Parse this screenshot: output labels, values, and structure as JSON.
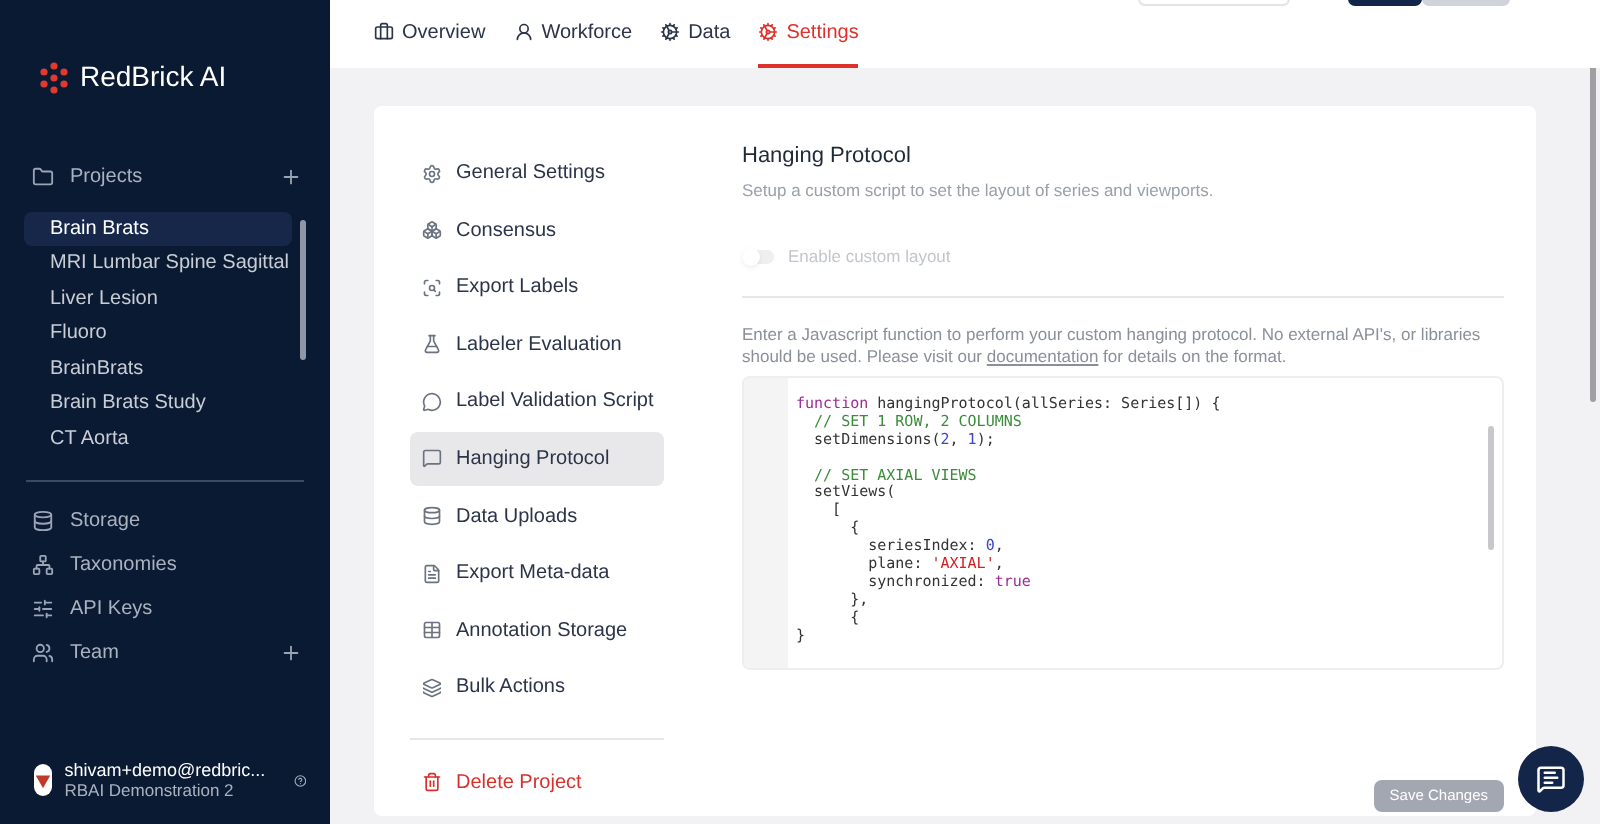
{
  "sidebar": {
    "logo": "RedBrick AI",
    "projects_header": {
      "label": "Projects",
      "add": true
    },
    "projects": [
      {
        "label": "Brain Brats",
        "selected": true
      },
      {
        "label": "MRI Lumbar Spine Sagittal",
        "selected": false
      },
      {
        "label": "Liver Lesion",
        "selected": false
      },
      {
        "label": "Fluoro",
        "selected": false
      },
      {
        "label": "BrainBrats",
        "selected": false
      },
      {
        "label": "Brain Brats Study",
        "selected": false
      },
      {
        "label": "CT Aorta",
        "selected": false
      }
    ],
    "nav": [
      {
        "label": "Storage",
        "add": false
      },
      {
        "label": "Taxonomies",
        "add": false
      },
      {
        "label": "API Keys",
        "add": false
      },
      {
        "label": "Team",
        "add": true
      }
    ],
    "user": {
      "email": "shivam+demo@redbric...",
      "org": "RBAI Demonstration 2"
    }
  },
  "tabs": [
    {
      "label": "Overview",
      "selected": false
    },
    {
      "label": "Workforce",
      "selected": false
    },
    {
      "label": "Data",
      "selected": false
    },
    {
      "label": "Settings",
      "selected": true
    }
  ],
  "settings_menu": [
    {
      "label": "General Settings",
      "selected": false,
      "kind": "normal"
    },
    {
      "label": "Consensus",
      "selected": false,
      "kind": "normal"
    },
    {
      "label": "Export Labels",
      "selected": false,
      "kind": "normal"
    },
    {
      "label": "Labeler Evaluation",
      "selected": false,
      "kind": "normal"
    },
    {
      "label": "Label Validation Script",
      "selected": false,
      "kind": "normal"
    },
    {
      "label": "Hanging Protocol",
      "selected": true,
      "kind": "normal"
    },
    {
      "label": "Data Uploads",
      "selected": false,
      "kind": "normal"
    },
    {
      "label": "Export Meta-data",
      "selected": false,
      "kind": "normal"
    },
    {
      "label": "Annotation Storage",
      "selected": false,
      "kind": "normal"
    },
    {
      "label": "Bulk Actions",
      "selected": false,
      "kind": "normal"
    },
    {
      "label": "Delete Project",
      "selected": false,
      "kind": "danger"
    }
  ],
  "panel": {
    "title": "Hanging Protocol",
    "subtitle": "Setup a custom script to set the layout of series and viewports.",
    "toggle": {
      "label": "Enable custom layout",
      "on": false,
      "disabled": true
    },
    "description": {
      "before": "Enter a Javascript function to perform your custom hanging protocol. No external API's, or libraries should be used. Please visit our",
      "link": "documentation",
      "after": "for details on the format."
    },
    "code": [
      {
        "kind": "code",
        "tokens": [
          {
            "t": "function",
            "kind": "keyword"
          },
          {
            "t": " hangingProtocol(allSeries: Series[]) {",
            "kind": "plain"
          }
        ]
      },
      {
        "kind": "code",
        "tokens": [
          {
            "t": "  // SET 1 ROW, 2 COLUMNS",
            "kind": "comment"
          }
        ]
      },
      {
        "kind": "code",
        "tokens": [
          {
            "t": "  setDimensions(",
            "kind": "plain"
          },
          {
            "t": "2",
            "kind": "number"
          },
          {
            "t": ", ",
            "kind": "plain"
          },
          {
            "t": "1",
            "kind": "number"
          },
          {
            "t": ");",
            "kind": "plain"
          }
        ]
      },
      {
        "kind": "blank"
      },
      {
        "kind": "code",
        "tokens": [
          {
            "t": "  // SET AXIAL VIEWS",
            "kind": "comment"
          }
        ]
      },
      {
        "kind": "code",
        "tokens": [
          {
            "t": "  setViews(",
            "kind": "plain"
          }
        ]
      },
      {
        "kind": "code",
        "tokens": [
          {
            "t": "    [",
            "kind": "plain"
          }
        ]
      },
      {
        "kind": "code",
        "tokens": [
          {
            "t": "      {",
            "kind": "plain"
          }
        ]
      },
      {
        "kind": "code",
        "tokens": [
          {
            "t": "        seriesIndex: ",
            "kind": "plain"
          },
          {
            "t": "0",
            "kind": "number"
          },
          {
            "t": ",",
            "kind": "plain"
          }
        ]
      },
      {
        "kind": "code",
        "tokens": [
          {
            "t": "        plane: ",
            "kind": "plain"
          },
          {
            "t": "'AXIAL'",
            "kind": "string"
          },
          {
            "t": ",",
            "kind": "plain"
          }
        ]
      },
      {
        "kind": "code",
        "tokens": [
          {
            "t": "        synchronized: ",
            "kind": "plain"
          },
          {
            "t": "true",
            "kind": "keyword"
          }
        ]
      },
      {
        "kind": "code",
        "tokens": [
          {
            "t": "      },",
            "kind": "plain"
          }
        ]
      },
      {
        "kind": "code",
        "tokens": [
          {
            "t": "      {",
            "kind": "plain"
          }
        ]
      },
      {
        "kind": "code",
        "tokens": [
          {
            "t": "}",
            "kind": "plain"
          }
        ]
      }
    ],
    "save_button": {
      "label": "Save Changes",
      "disabled": true
    }
  }
}
